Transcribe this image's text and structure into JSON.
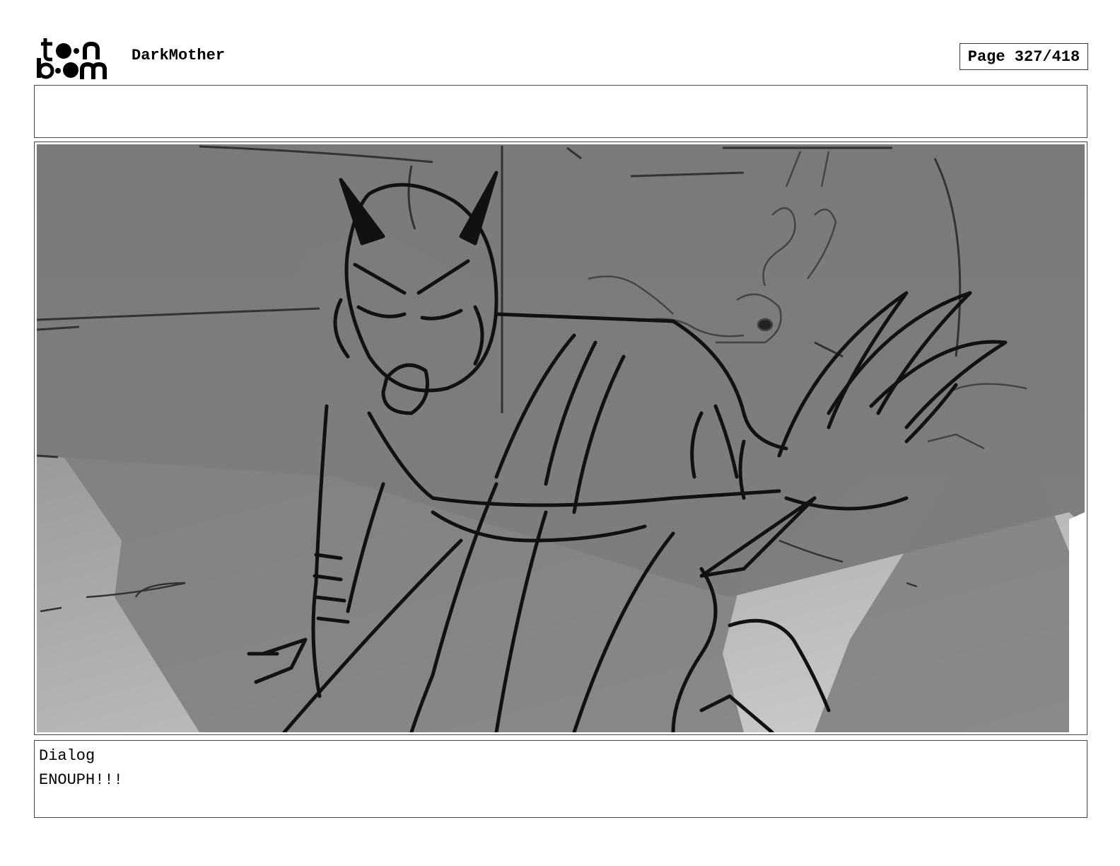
{
  "header": {
    "logo_icon": "toon-boom-logo",
    "project_title": "DarkMother",
    "page_number": "Page 327/418"
  },
  "notes": {
    "text": ""
  },
  "panel": {
    "image_icon": "storyboard-sketch",
    "colors": {
      "background": "#7a7a7a",
      "floor_light": "#c4c4c4",
      "ink": "#111111"
    }
  },
  "dialog": {
    "label": "Dialog",
    "text": "ENOUPH!!!"
  }
}
